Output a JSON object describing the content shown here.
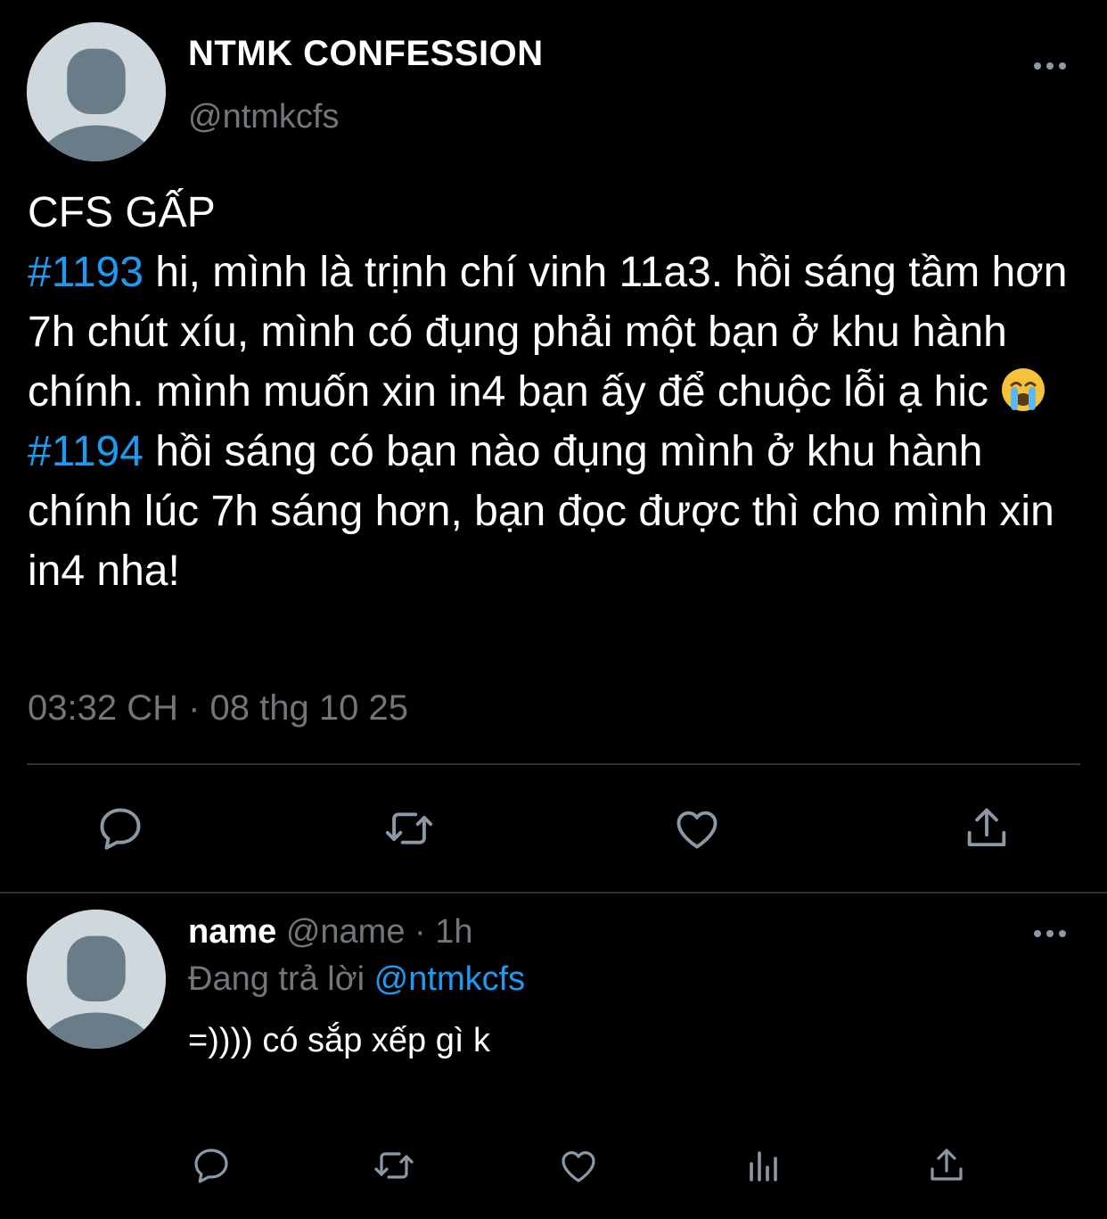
{
  "tweet": {
    "author_name": "NTMK CONFESSION",
    "author_handle": "@ntmkcfs",
    "title_line": "CFS GẤP",
    "post1_tag": "#1193",
    "post1_text_a": " hi, mình là trịnh chí vinh 11a3. hồi sáng tầm hơn 7h chút xíu, mình có đụng phải một bạn ở khu hành chính. mình muốn xin in4 bạn ấy để chuộc lỗi ạ hic ",
    "post1_emoji": "loudly-crying-face-emoji",
    "post2_tag": "#1194",
    "post2_text": " hồi sáng có bạn nào đụng mình ở khu hành chính lúc 7h sáng hơn, bạn đọc được thì cho mình xin in4 nha!",
    "timestamp": "03:32 CH · 08 thg 10 25",
    "actions": [
      "reply-icon",
      "retweet-icon",
      "like-icon",
      "share-icon"
    ]
  },
  "reply": {
    "name": "name",
    "handle": "@name",
    "separator": " · ",
    "time": "1h",
    "replying_label": "Đang trả lời ",
    "replying_handle": "@ntmkcfs",
    "text": "=)))) có sắp xếp gì k",
    "actions": [
      "reply-icon",
      "retweet-icon",
      "like-icon",
      "analytics-icon",
      "share-icon"
    ]
  },
  "colors": {
    "background": "#000000",
    "text": "#ffffff",
    "secondary_text": "#71767b",
    "link": "#1d9bf0",
    "divider": "#2f3336",
    "avatar_bg": "#cfd8dd",
    "avatar_fg": "#6b7c89"
  }
}
